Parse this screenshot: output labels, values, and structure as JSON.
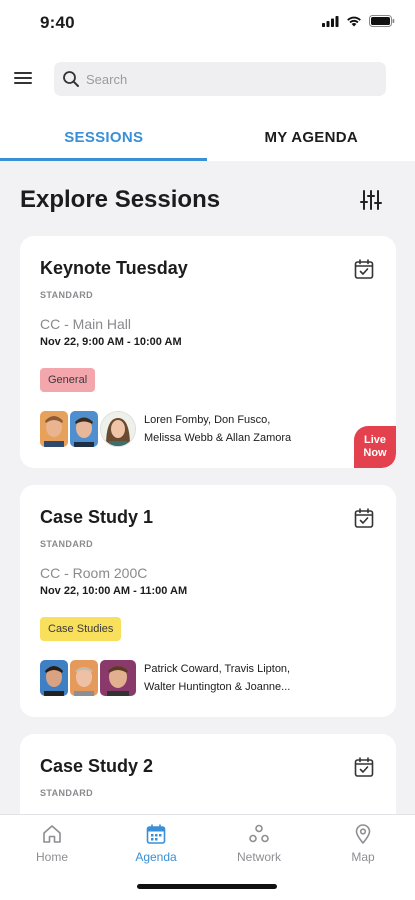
{
  "status_bar": {
    "time": "9:40"
  },
  "search": {
    "placeholder": "Search"
  },
  "tabs": [
    {
      "label": "SESSIONS",
      "active": true
    },
    {
      "label": "MY AGENDA",
      "active": false
    }
  ],
  "page_title": "Explore Sessions",
  "sessions": [
    {
      "title": "Keynote Tuesday",
      "type": "STANDARD",
      "location": "CC - Main Hall",
      "time": "Nov 22, 9:00 AM - 10:00 AM",
      "tag": "General",
      "speakers_line1": "Loren Fomby, Don Fusco,",
      "speakers_line2": "Melissa Webb & Allan Zamora",
      "live_line1": "Live",
      "live_line2": "Now"
    },
    {
      "title": "Case Study 1",
      "type": "STANDARD",
      "location": "CC - Room 200C",
      "time": "Nov 22, 10:00 AM - 11:00 AM",
      "tag": "Case Studies",
      "speakers_line1": "Patrick Coward, Travis Lipton,",
      "speakers_line2": "Walter Huntington & Joanne..."
    },
    {
      "title": "Case Study 2",
      "type": "STANDARD"
    }
  ],
  "bottom_nav": [
    {
      "label": "Home",
      "icon": "home-icon"
    },
    {
      "label": "Agenda",
      "icon": "calendar-icon",
      "active": true
    },
    {
      "label": "Network",
      "icon": "network-icon"
    },
    {
      "label": "Map",
      "icon": "map-pin-icon"
    }
  ],
  "colors": {
    "accent": "#3a8fd6",
    "live": "#e4414f",
    "tag_general": "#f3a6ab",
    "tag_case_studies": "#f8df5c",
    "background": "#f2f2f4"
  }
}
